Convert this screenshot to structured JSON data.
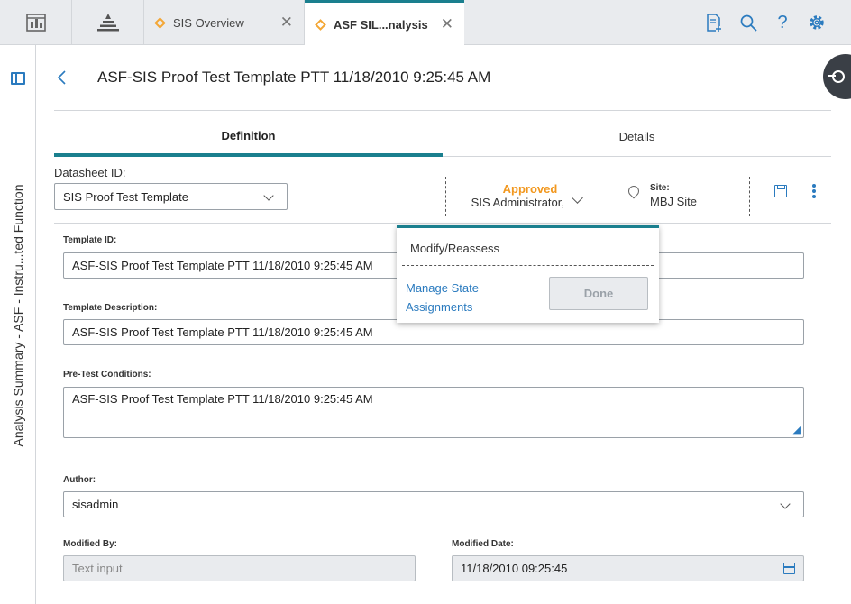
{
  "tabs": [
    {
      "label": "SIS Overview",
      "active": false
    },
    {
      "label": "ASF SIL...nalysis",
      "active": true
    }
  ],
  "left_rail": {
    "title": "Analysis Summary - ASF - Instru...ted Function"
  },
  "header": {
    "title": "ASF-SIS Proof Test Template PTT 11/18/2010 9:25:45 AM"
  },
  "subtabs": [
    {
      "label": "Definition",
      "active": true
    },
    {
      "label": "Details",
      "active": false
    }
  ],
  "datasheet": {
    "label": "Datasheet ID:",
    "value": "SIS Proof Test Template"
  },
  "state": {
    "label": "Approved",
    "user": "SIS Administrator,",
    "color": "#f2981f"
  },
  "site": {
    "label": "Site:",
    "value": "MBJ Site"
  },
  "form": {
    "template_id": {
      "label": "Template ID:",
      "value": "ASF-SIS Proof Test Template PTT 11/18/2010 9:25:45 AM"
    },
    "template_description": {
      "label": "Template Description:",
      "value": "ASF-SIS Proof Test Template PTT 11/18/2010 9:25:45 AM"
    },
    "pre_test_conditions": {
      "label": "Pre-Test Conditions:",
      "value": "ASF-SIS Proof Test Template PTT 11/18/2010 9:25:45 AM"
    },
    "author": {
      "label": "Author:",
      "value": "sisadmin"
    },
    "modified_by": {
      "label": "Modified By:",
      "placeholder": "Text input"
    },
    "modified_date": {
      "label": "Modified Date:",
      "value": "11/18/2010 09:25:45"
    }
  },
  "popover": {
    "title": "Modify/Reassess",
    "link": "Manage State Assignments",
    "done_label": "Done"
  },
  "colors": {
    "accent": "#1a7f8e",
    "link": "#2b7bbf"
  }
}
